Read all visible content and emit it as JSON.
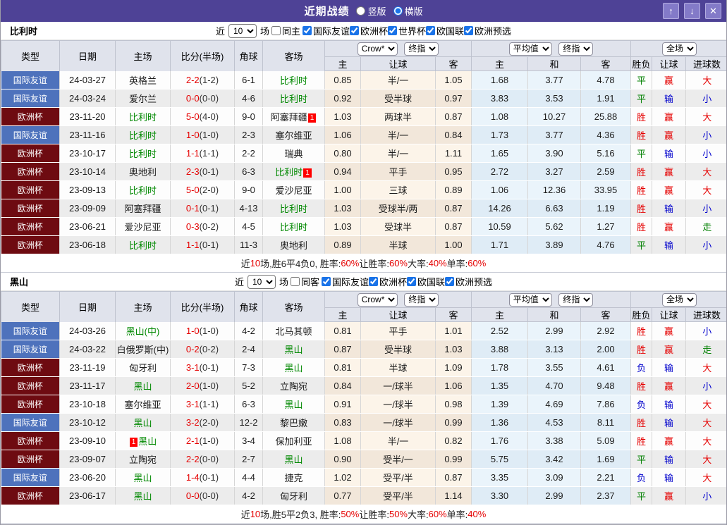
{
  "titlebar": {
    "title": "近期战绩",
    "radio_vertical": "竖版",
    "radio_horizontal": "横版",
    "selected_layout": "横版",
    "up_button": "↑",
    "down_button": "↓",
    "close_button": "✕"
  },
  "columns": {
    "type": "类型",
    "date": "日期",
    "home": "主场",
    "score": "比分(半场)",
    "corner": "角球",
    "away": "客场",
    "sub": [
      "主",
      "让球",
      "客",
      "主",
      "和",
      "客",
      "胜负",
      "让球",
      "进球数"
    ],
    "bookmaker_select": "Crow*",
    "final_select_1": "终指",
    "average_select": "平均值",
    "final_select_2": "终指",
    "fulltime_select": "全场"
  },
  "colors": {
    "titlebar_bg": "#4e4296",
    "friendly_badge": "#4e72bc",
    "cup_badge": "#6e0b11",
    "focus_team": "#008800",
    "score_main": "#e50000",
    "type_map": {
      "国际友谊": "#4e72bc",
      "欧洲杯": "#6e0b11"
    },
    "result_map": {
      "胜": "#e50000",
      "负": "#0000cc",
      "平": "#008000",
      "赢": "#e50000",
      "输": "#0000cc",
      "走": "#008000",
      "大": "#e50000",
      "小": "#0000cc"
    }
  },
  "sections": [
    {
      "team": "比利时",
      "filter": {
        "near_label": "近",
        "matches_value": "10",
        "unit_label": "场",
        "same_label": "同主",
        "same_checked": false,
        "competitions": [
          {
            "label": "国际友谊",
            "checked": true
          },
          {
            "label": "欧洲杯",
            "checked": true
          },
          {
            "label": "世界杯",
            "checked": true
          },
          {
            "label": "欧国联",
            "checked": true
          },
          {
            "label": "欧洲预选",
            "checked": true
          }
        ]
      },
      "rows": [
        {
          "type": "国际友谊",
          "date": "24-03-27",
          "home": "英格兰",
          "home_focus": false,
          "home_card_pre": "",
          "home_card_suf": "",
          "score": "2-2",
          "half": "(1-2)",
          "corner": "6-1",
          "away": "比利时",
          "away_focus": true,
          "away_card_suf": "",
          "odds": [
            "0.85",
            "半/一",
            "1.05"
          ],
          "avg": [
            "1.68",
            "3.77",
            "4.78"
          ],
          "results": [
            "平",
            "赢",
            "大"
          ]
        },
        {
          "type": "国际友谊",
          "date": "24-03-24",
          "home": "爱尔兰",
          "home_focus": false,
          "home_card_pre": "",
          "home_card_suf": "",
          "score": "0-0",
          "half": "(0-0)",
          "corner": "4-6",
          "away": "比利时",
          "away_focus": true,
          "away_card_suf": "",
          "odds": [
            "0.92",
            "受半球",
            "0.97"
          ],
          "avg": [
            "3.83",
            "3.53",
            "1.91"
          ],
          "results": [
            "平",
            "输",
            "小"
          ]
        },
        {
          "type": "欧洲杯",
          "date": "23-11-20",
          "home": "比利时",
          "home_focus": true,
          "home_card_pre": "",
          "home_card_suf": "",
          "score": "5-0",
          "half": "(4-0)",
          "corner": "9-0",
          "away": "阿塞拜疆",
          "away_focus": false,
          "away_card_suf": "1",
          "odds": [
            "1.03",
            "两球半",
            "0.87"
          ],
          "avg": [
            "1.08",
            "10.27",
            "25.88"
          ],
          "results": [
            "胜",
            "赢",
            "大"
          ]
        },
        {
          "type": "国际友谊",
          "date": "23-11-16",
          "home": "比利时",
          "home_focus": true,
          "home_card_pre": "",
          "home_card_suf": "",
          "score": "1-0",
          "half": "(1-0)",
          "corner": "2-3",
          "away": "塞尔维亚",
          "away_focus": false,
          "away_card_suf": "",
          "odds": [
            "1.06",
            "半/一",
            "0.84"
          ],
          "avg": [
            "1.73",
            "3.77",
            "4.36"
          ],
          "results": [
            "胜",
            "赢",
            "小"
          ]
        },
        {
          "type": "欧洲杯",
          "date": "23-10-17",
          "home": "比利时",
          "home_focus": true,
          "home_card_pre": "",
          "home_card_suf": "",
          "score": "1-1",
          "half": "(1-1)",
          "corner": "2-2",
          "away": "瑞典",
          "away_focus": false,
          "away_card_suf": "",
          "odds": [
            "0.80",
            "半/一",
            "1.11"
          ],
          "avg": [
            "1.65",
            "3.90",
            "5.16"
          ],
          "results": [
            "平",
            "输",
            "小"
          ]
        },
        {
          "type": "欧洲杯",
          "date": "23-10-14",
          "home": "奥地利",
          "home_focus": false,
          "home_card_pre": "",
          "home_card_suf": "",
          "score": "2-3",
          "half": "(0-1)",
          "corner": "6-3",
          "away": "比利时",
          "away_focus": true,
          "away_card_suf": "1",
          "odds": [
            "0.94",
            "平手",
            "0.95"
          ],
          "avg": [
            "2.72",
            "3.27",
            "2.59"
          ],
          "results": [
            "胜",
            "赢",
            "大"
          ]
        },
        {
          "type": "欧洲杯",
          "date": "23-09-13",
          "home": "比利时",
          "home_focus": true,
          "home_card_pre": "",
          "home_card_suf": "",
          "score": "5-0",
          "half": "(2-0)",
          "corner": "9-0",
          "away": "爱沙尼亚",
          "away_focus": false,
          "away_card_suf": "",
          "odds": [
            "1.00",
            "三球",
            "0.89"
          ],
          "avg": [
            "1.06",
            "12.36",
            "33.95"
          ],
          "results": [
            "胜",
            "赢",
            "大"
          ]
        },
        {
          "type": "欧洲杯",
          "date": "23-09-09",
          "home": "阿塞拜疆",
          "home_focus": false,
          "home_card_pre": "",
          "home_card_suf": "",
          "score": "0-1",
          "half": "(0-1)",
          "corner": "4-13",
          "away": "比利时",
          "away_focus": true,
          "away_card_suf": "",
          "odds": [
            "1.03",
            "受球半/两",
            "0.87"
          ],
          "avg": [
            "14.26",
            "6.63",
            "1.19"
          ],
          "results": [
            "胜",
            "输",
            "小"
          ]
        },
        {
          "type": "欧洲杯",
          "date": "23-06-21",
          "home": "爱沙尼亚",
          "home_focus": false,
          "home_card_pre": "",
          "home_card_suf": "",
          "score": "0-3",
          "half": "(0-2)",
          "corner": "4-5",
          "away": "比利时",
          "away_focus": true,
          "away_card_suf": "",
          "odds": [
            "1.03",
            "受球半",
            "0.87"
          ],
          "avg": [
            "10.59",
            "5.62",
            "1.27"
          ],
          "results": [
            "胜",
            "赢",
            "走"
          ]
        },
        {
          "type": "欧洲杯",
          "date": "23-06-18",
          "home": "比利时",
          "home_focus": true,
          "home_card_pre": "",
          "home_card_suf": "",
          "score": "1-1",
          "half": "(0-1)",
          "corner": "11-3",
          "away": "奥地利",
          "away_focus": false,
          "away_card_suf": "",
          "odds": [
            "0.89",
            "半球",
            "1.00"
          ],
          "avg": [
            "1.71",
            "3.89",
            "4.76"
          ],
          "results": [
            "平",
            "输",
            "小"
          ]
        }
      ],
      "summary_segments": [
        {
          "t": "近",
          "c": "k"
        },
        {
          "t": "10",
          "c": "r"
        },
        {
          "t": "场,胜6平4负0, 胜率:",
          "c": "k"
        },
        {
          "t": "60%",
          "c": "r"
        },
        {
          "t": " 让胜率:",
          "c": "k"
        },
        {
          "t": "60%",
          "c": "r"
        },
        {
          "t": " 大率:",
          "c": "k"
        },
        {
          "t": "40%",
          "c": "r"
        },
        {
          "t": " 单率:",
          "c": "k"
        },
        {
          "t": "60%",
          "c": "r"
        }
      ]
    },
    {
      "team": "黑山",
      "filter": {
        "near_label": "近",
        "matches_value": "10",
        "unit_label": "场",
        "same_label": "同客",
        "same_checked": false,
        "competitions": [
          {
            "label": "国际友谊",
            "checked": true
          },
          {
            "label": "欧洲杯",
            "checked": true
          },
          {
            "label": "欧国联",
            "checked": true
          },
          {
            "label": "欧洲预选",
            "checked": true
          }
        ]
      },
      "rows": [
        {
          "type": "国际友谊",
          "date": "24-03-26",
          "home": "黑山(中)",
          "home_focus": true,
          "home_card_pre": "",
          "home_card_suf": "",
          "score": "1-0",
          "half": "(1-0)",
          "corner": "4-2",
          "away": "北马其顿",
          "away_focus": false,
          "away_card_suf": "",
          "odds": [
            "0.81",
            "平手",
            "1.01"
          ],
          "avg": [
            "2.52",
            "2.99",
            "2.92"
          ],
          "results": [
            "胜",
            "赢",
            "小"
          ]
        },
        {
          "type": "国际友谊",
          "date": "24-03-22",
          "home": "白俄罗斯(中)",
          "home_focus": false,
          "home_card_pre": "",
          "home_card_suf": "",
          "score": "0-2",
          "half": "(0-2)",
          "corner": "2-4",
          "away": "黑山",
          "away_focus": true,
          "away_card_suf": "",
          "odds": [
            "0.87",
            "受半球",
            "1.03"
          ],
          "avg": [
            "3.88",
            "3.13",
            "2.00"
          ],
          "results": [
            "胜",
            "赢",
            "走"
          ]
        },
        {
          "type": "欧洲杯",
          "date": "23-11-19",
          "home": "匈牙利",
          "home_focus": false,
          "home_card_pre": "",
          "home_card_suf": "",
          "score": "3-1",
          "half": "(0-1)",
          "corner": "7-3",
          "away": "黑山",
          "away_focus": true,
          "away_card_suf": "",
          "odds": [
            "0.81",
            "半球",
            "1.09"
          ],
          "avg": [
            "1.78",
            "3.55",
            "4.61"
          ],
          "results": [
            "负",
            "输",
            "大"
          ]
        },
        {
          "type": "欧洲杯",
          "date": "23-11-17",
          "home": "黑山",
          "home_focus": true,
          "home_card_pre": "",
          "home_card_suf": "",
          "score": "2-0",
          "half": "(1-0)",
          "corner": "5-2",
          "away": "立陶宛",
          "away_focus": false,
          "away_card_suf": "",
          "odds": [
            "0.84",
            "一/球半",
            "1.06"
          ],
          "avg": [
            "1.35",
            "4.70",
            "9.48"
          ],
          "results": [
            "胜",
            "赢",
            "小"
          ]
        },
        {
          "type": "欧洲杯",
          "date": "23-10-18",
          "home": "塞尔维亚",
          "home_focus": false,
          "home_card_pre": "",
          "home_card_suf": "",
          "score": "3-1",
          "half": "(1-1)",
          "corner": "6-3",
          "away": "黑山",
          "away_focus": true,
          "away_card_suf": "",
          "odds": [
            "0.91",
            "一/球半",
            "0.98"
          ],
          "avg": [
            "1.39",
            "4.69",
            "7.86"
          ],
          "results": [
            "负",
            "输",
            "大"
          ]
        },
        {
          "type": "国际友谊",
          "date": "23-10-12",
          "home": "黑山",
          "home_focus": true,
          "home_card_pre": "",
          "home_card_suf": "",
          "score": "3-2",
          "half": "(2-0)",
          "corner": "12-2",
          "away": "黎巴嫩",
          "away_focus": false,
          "away_card_suf": "",
          "odds": [
            "0.83",
            "一/球半",
            "0.99"
          ],
          "avg": [
            "1.36",
            "4.53",
            "8.11"
          ],
          "results": [
            "胜",
            "输",
            "大"
          ]
        },
        {
          "type": "欧洲杯",
          "date": "23-09-10",
          "home": "黑山",
          "home_focus": true,
          "home_card_pre": "1",
          "home_card_suf": "",
          "score": "2-1",
          "half": "(1-0)",
          "corner": "3-4",
          "away": "保加利亚",
          "away_focus": false,
          "away_card_suf": "",
          "odds": [
            "1.08",
            "半/一",
            "0.82"
          ],
          "avg": [
            "1.76",
            "3.38",
            "5.09"
          ],
          "results": [
            "胜",
            "赢",
            "大"
          ]
        },
        {
          "type": "欧洲杯",
          "date": "23-09-07",
          "home": "立陶宛",
          "home_focus": false,
          "home_card_pre": "",
          "home_card_suf": "",
          "score": "2-2",
          "half": "(0-0)",
          "corner": "2-7",
          "away": "黑山",
          "away_focus": true,
          "away_card_suf": "",
          "odds": [
            "0.90",
            "受半/一",
            "0.99"
          ],
          "avg": [
            "5.75",
            "3.42",
            "1.69"
          ],
          "results": [
            "平",
            "输",
            "大"
          ]
        },
        {
          "type": "国际友谊",
          "date": "23-06-20",
          "home": "黑山",
          "home_focus": true,
          "home_card_pre": "",
          "home_card_suf": "",
          "score": "1-4",
          "half": "(0-1)",
          "corner": "4-4",
          "away": "捷克",
          "away_focus": false,
          "away_card_suf": "",
          "odds": [
            "1.02",
            "受平/半",
            "0.87"
          ],
          "avg": [
            "3.35",
            "3.09",
            "2.21"
          ],
          "results": [
            "负",
            "输",
            "大"
          ]
        },
        {
          "type": "欧洲杯",
          "date": "23-06-17",
          "home": "黑山",
          "home_focus": true,
          "home_card_pre": "",
          "home_card_suf": "",
          "score": "0-0",
          "half": "(0-0)",
          "corner": "4-2",
          "away": "匈牙利",
          "away_focus": false,
          "away_card_suf": "",
          "odds": [
            "0.77",
            "受平/半",
            "1.14"
          ],
          "avg": [
            "3.30",
            "2.99",
            "2.37"
          ],
          "results": [
            "平",
            "赢",
            "小"
          ]
        }
      ],
      "summary_segments": [
        {
          "t": "近",
          "c": "k"
        },
        {
          "t": "10",
          "c": "r"
        },
        {
          "t": "场,胜5平2负3, 胜率:",
          "c": "k"
        },
        {
          "t": "50%",
          "c": "r"
        },
        {
          "t": " 让胜率:",
          "c": "k"
        },
        {
          "t": "50%",
          "c": "r"
        },
        {
          "t": " 大率:",
          "c": "k"
        },
        {
          "t": "60%",
          "c": "r"
        },
        {
          "t": " 单率:",
          "c": "k"
        },
        {
          "t": "40%",
          "c": "r"
        }
      ]
    }
  ]
}
